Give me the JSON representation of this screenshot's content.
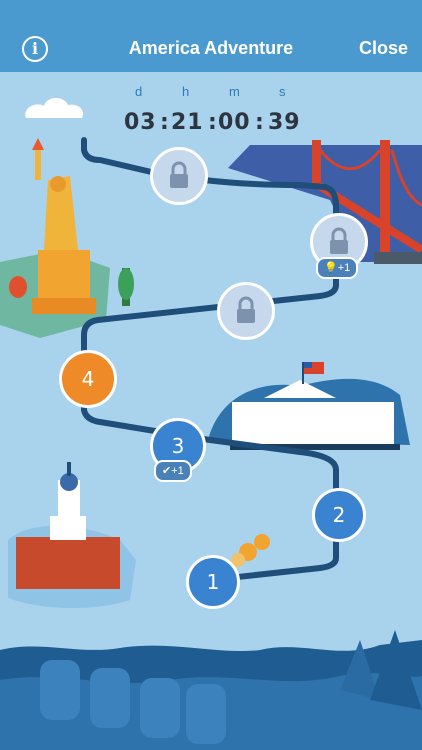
{
  "header": {
    "title": "America Adventure",
    "close_label": "Close",
    "info_label": "i"
  },
  "timer": {
    "labels": [
      "d",
      "h",
      "m",
      "s"
    ],
    "values": [
      "03",
      "21",
      "00",
      "39"
    ],
    "separator": ":"
  },
  "levels": [
    {
      "label": "1",
      "state": "available"
    },
    {
      "label": "2",
      "state": "available"
    },
    {
      "label": "3",
      "state": "available"
    },
    {
      "label": "4",
      "state": "in-progress"
    },
    {
      "state": "locked"
    },
    {
      "state": "locked"
    },
    {
      "state": "locked"
    }
  ],
  "badges": {
    "hint_text": "+1",
    "completed_text": "+1"
  },
  "colors": {
    "header": "#4a9ad0",
    "background": "#a9d2ec",
    "path": "#1f4e7a",
    "node_blue": "#3a83d0",
    "node_orange": "#ef8a28",
    "node_locked": "#c5d8ec"
  },
  "icons": [
    "info-icon",
    "lock-icon",
    "lightbulb-icon",
    "checkmark-icon"
  ]
}
